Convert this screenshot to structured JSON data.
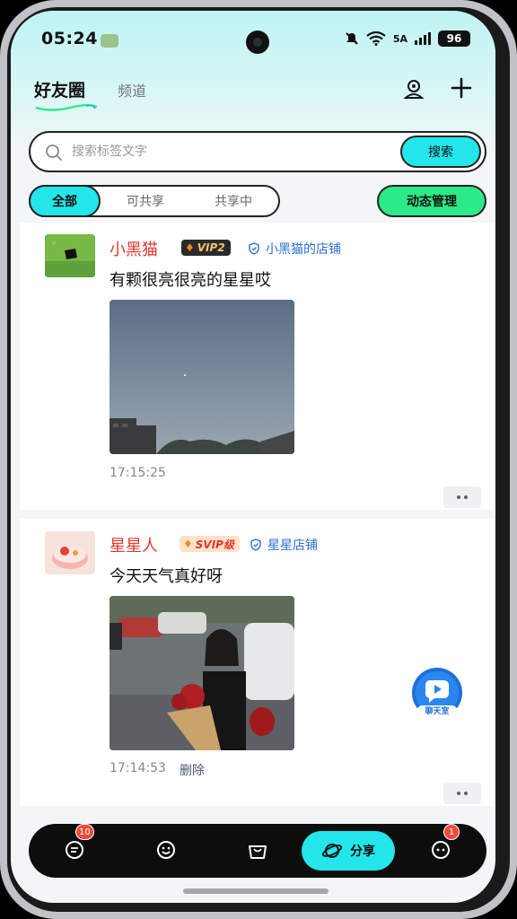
{
  "status_bar": {
    "time": "05:24",
    "network": "5A",
    "battery": "96"
  },
  "header": {
    "tab_active": "好友圈",
    "tab_inactive": "频道"
  },
  "search": {
    "placeholder": "搜索标签文字",
    "button": "搜索"
  },
  "filter": {
    "tabs": [
      "全部",
      "可共享",
      "共享中"
    ],
    "active": "全部",
    "manage_button": "动态管理"
  },
  "posts": [
    {
      "username": "小黑猫",
      "badge": "VIP2",
      "shop": "小黑猫的店铺",
      "text": "有颗很亮很亮的星星哎",
      "time": "17:15:25"
    },
    {
      "username": "星星人",
      "badge": "SVIP级",
      "shop": "星星店铺",
      "text": "今天天气真好呀",
      "time": "17:14:53",
      "delete_label": "删除"
    }
  ],
  "floating_chat": {
    "label": "聊天室"
  },
  "bottom_nav": {
    "messages_badge": "10",
    "profile_badge": "1",
    "share_label": "分享",
    "active": "share"
  },
  "colors": {
    "accent_cyan": "#22e6ea",
    "accent_green": "#2bea88",
    "username_red": "#e8352f",
    "shop_blue": "#2b6fd6"
  }
}
